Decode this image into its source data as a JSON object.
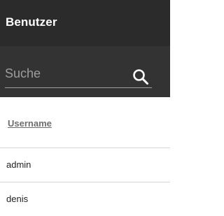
{
  "header": {
    "title": "Benutzer"
  },
  "search": {
    "placeholder": "Suche",
    "value": "",
    "icon": "search-icon"
  },
  "table": {
    "columns": [
      {
        "label": "Username"
      }
    ],
    "rows": [
      {
        "username": "admin"
      },
      {
        "username": "denis"
      }
    ]
  },
  "colors": {
    "topbar": "#2b2b2b",
    "searchbar": "#333333",
    "divider": "#d6d6d6"
  }
}
